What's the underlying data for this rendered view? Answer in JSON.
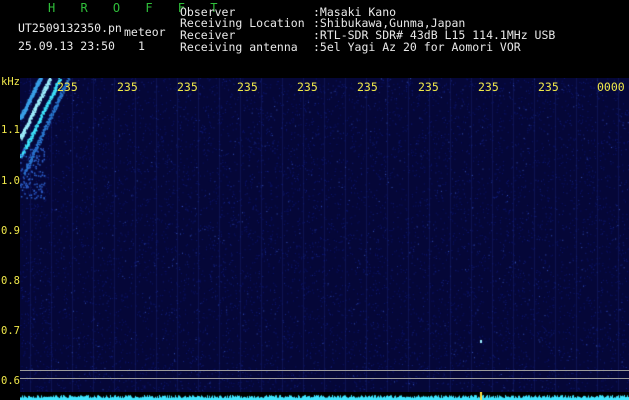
{
  "header": {
    "app_title": "H R O F F T",
    "filename": "UT2509132350.pn",
    "mode": "meteor",
    "datetime": "25.09.13 23:50",
    "count": "1",
    "fields": [
      {
        "label": "Observer",
        "value": ":Masaki Kano"
      },
      {
        "label": "Receiving Location",
        "value": ":Shibukawa,Gunma,Japan"
      },
      {
        "label": "Receiver",
        "value": ":RTL-SDR SDR# 43dB L15 114.1MHz USB"
      },
      {
        "label": "Receiving antenna",
        "value": ":5el Yagi Az 20 for Aomori VOR"
      }
    ]
  },
  "axis": {
    "unit": "kHz",
    "x_ticks": [
      "235",
      "235",
      "235",
      "235",
      "235",
      "235",
      "235",
      "235",
      "235",
      "0000"
    ],
    "y_ticks": [
      "1.1",
      "1.0",
      "0.9",
      "0.8",
      "0.7",
      "0.6"
    ]
  },
  "colors": {
    "background": "#000000",
    "plot_bg": "#050738",
    "tick_text": "#f0e84a",
    "title_green": "#2fbf3a",
    "signal_cyan": "#3fe6ff",
    "marker_yellow": "#ffe040"
  }
}
